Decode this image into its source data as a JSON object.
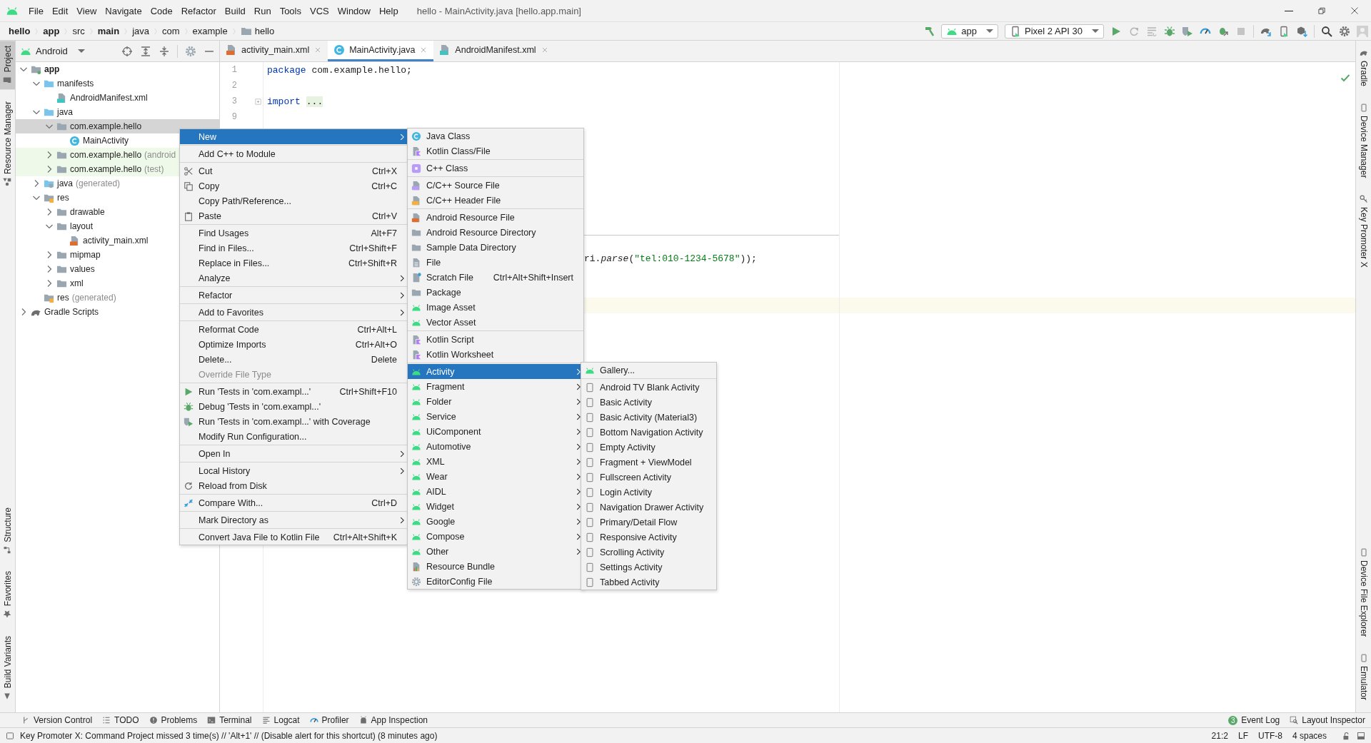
{
  "window": {
    "title": "hello - MainActivity.java [hello.app.main]"
  },
  "menu_bar": [
    "File",
    "Edit",
    "View",
    "Navigate",
    "Code",
    "Refactor",
    "Build",
    "Run",
    "Tools",
    "VCS",
    "Window",
    "Help"
  ],
  "breadcrumbs": [
    {
      "label": "hello",
      "bold": true,
      "folder_icon": false
    },
    {
      "label": "app",
      "bold": true,
      "folder_icon": false
    },
    {
      "label": "src",
      "bold": false,
      "folder_icon": false
    },
    {
      "label": "main",
      "bold": true,
      "folder_icon": false
    },
    {
      "label": "java",
      "bold": false,
      "folder_icon": false
    },
    {
      "label": "com",
      "bold": false,
      "folder_icon": false
    },
    {
      "label": "example",
      "bold": false,
      "folder_icon": false
    },
    {
      "label": "hello",
      "bold": false,
      "folder_icon": true
    }
  ],
  "toolbar": {
    "module_selector": "app",
    "device_selector": "Pixel 2 API 30"
  },
  "left_tool_windows": {
    "top": [
      {
        "label": "Project",
        "kind": "project",
        "selected": true
      },
      {
        "label": "Resource Manager",
        "kind": "resources",
        "selected": false
      }
    ],
    "bottom": [
      {
        "label": "Structure",
        "kind": "structure",
        "selected": false
      },
      {
        "label": "Favorites",
        "kind": "favorites",
        "selected": false
      },
      {
        "label": "Build Variants",
        "kind": "variants",
        "selected": false
      }
    ]
  },
  "right_tool_windows": {
    "top": [
      {
        "label": "Gradle",
        "kind": "gradle",
        "selected": false
      },
      {
        "label": "Device Manager",
        "kind": "device",
        "selected": false
      },
      {
        "label": "Key Promoter X",
        "kind": "key",
        "selected": false
      }
    ],
    "bottom": [
      {
        "label": "Device File Explorer",
        "kind": "device",
        "selected": false
      },
      {
        "label": "Emulator",
        "kind": "device",
        "selected": false
      }
    ]
  },
  "project_panel": {
    "view_selector": "Android",
    "tree": [
      {
        "label": "app",
        "kind": "module",
        "expanded": true,
        "selected": false,
        "children": [
          {
            "label": "manifests",
            "kind": "srcfolder",
            "expanded": true,
            "selected": false,
            "children": [
              {
                "label": "AndroidManifest.xml",
                "kind": "manifest",
                "selected": false
              }
            ]
          },
          {
            "label": "java",
            "kind": "srcfolder",
            "expanded": true,
            "selected": false,
            "children": [
              {
                "label": "com.example.hello",
                "kind": "package",
                "expanded": true,
                "selected": true,
                "children": [
                  {
                    "label": "MainActivity",
                    "kind": "class",
                    "selected": false
                  }
                ]
              },
              {
                "label": "com.example.hello",
                "suffix": "(android",
                "kind": "testpackage",
                "expanded": false,
                "selected": false
              },
              {
                "label": "com.example.hello",
                "suffix": "(test)",
                "kind": "testpackage",
                "expanded": false,
                "selected": false
              }
            ]
          },
          {
            "label": "java",
            "suffix": "(generated)",
            "kind": "genfolder",
            "expanded": false,
            "selected": false
          },
          {
            "label": "res",
            "kind": "resfolder",
            "expanded": true,
            "selected": false,
            "children": [
              {
                "label": "drawable",
                "kind": "package",
                "expanded": false,
                "selected": false
              },
              {
                "label": "layout",
                "kind": "package",
                "expanded": true,
                "selected": false,
                "children": [
                  {
                    "label": "activity_main.xml",
                    "kind": "xml",
                    "selected": false
                  }
                ]
              },
              {
                "label": "mipmap",
                "kind": "package",
                "expanded": false,
                "selected": false
              },
              {
                "label": "values",
                "kind": "package",
                "expanded": false,
                "selected": false
              },
              {
                "label": "xml",
                "kind": "package",
                "expanded": false,
                "selected": false
              }
            ]
          },
          {
            "label": "res",
            "suffix": "(generated)",
            "kind": "resfolder",
            "selected": false
          }
        ]
      },
      {
        "label": "Gradle Scripts",
        "kind": "gradle",
        "expanded": false,
        "selected": false
      }
    ]
  },
  "editor": {
    "tabs": [
      {
        "label": "activity_main.xml",
        "kind": "xml",
        "selected": false
      },
      {
        "label": "MainActivity.java",
        "kind": "class",
        "selected": true
      },
      {
        "label": "AndroidManifest.xml",
        "kind": "manifest",
        "selected": false
      }
    ],
    "lines": [
      {
        "number": "1",
        "tokens": [
          {
            "kind": "keyword",
            "text": "package"
          },
          {
            "kind": "plain",
            "text": " com.example.hello;"
          }
        ]
      },
      {
        "number": "2"
      },
      {
        "number": "3",
        "tokens": [
          {
            "kind": "keyword",
            "text": "import"
          },
          {
            "kind": "folded",
            "text": "..."
          }
        ]
      },
      {
        "number": "9"
      }
    ],
    "partly_hidden_line": [
      {
        "kind": "plain",
        "text": "ri."
      },
      {
        "kind": "method",
        "text": "parse"
      },
      {
        "kind": "plain",
        "text": "("
      },
      {
        "kind": "string",
        "text": "\"tel:010-1234-5678\""
      },
      {
        "kind": "plain",
        "text": "));"
      }
    ]
  },
  "context_menu": {
    "groups": [
      [
        {
          "label": "New",
          "submenu": true,
          "selected": true,
          "disabled": false
        }
      ],
      [
        {
          "label": "Add C++ to Module",
          "submenu": false,
          "selected": false,
          "disabled": false
        }
      ],
      [
        {
          "label": "Cut",
          "shortcut": "Ctrl+X",
          "kind": "cut",
          "submenu": false,
          "selected": false,
          "disabled": false
        },
        {
          "label": "Copy",
          "shortcut": "Ctrl+C",
          "kind": "copy",
          "submenu": false,
          "selected": false,
          "disabled": false
        },
        {
          "label": "Copy Path/Reference...",
          "submenu": false,
          "selected": false,
          "disabled": false
        },
        {
          "label": "Paste",
          "shortcut": "Ctrl+V",
          "kind": "paste",
          "submenu": false,
          "selected": false,
          "disabled": false
        }
      ],
      [
        {
          "label": "Find Usages",
          "shortcut": "Alt+F7",
          "submenu": false,
          "selected": false,
          "disabled": false
        },
        {
          "label": "Find in Files...",
          "shortcut": "Ctrl+Shift+F",
          "submenu": false,
          "selected": false,
          "disabled": false
        },
        {
          "label": "Replace in Files...",
          "shortcut": "Ctrl+Shift+R",
          "submenu": false,
          "selected": false,
          "disabled": false
        },
        {
          "label": "Analyze",
          "submenu": true,
          "selected": false,
          "disabled": false
        }
      ],
      [
        {
          "label": "Refactor",
          "submenu": true,
          "selected": false,
          "disabled": false
        }
      ],
      [
        {
          "label": "Add to Favorites",
          "submenu": true,
          "selected": false,
          "disabled": false
        }
      ],
      [
        {
          "label": "Reformat Code",
          "shortcut": "Ctrl+Alt+L",
          "submenu": false,
          "selected": false,
          "disabled": false
        },
        {
          "label": "Optimize Imports",
          "shortcut": "Ctrl+Alt+O",
          "submenu": false,
          "selected": false,
          "disabled": false
        },
        {
          "label": "Delete...",
          "shortcut": "Delete",
          "submenu": false,
          "selected": false,
          "disabled": false
        },
        {
          "label": "Override File Type",
          "submenu": false,
          "selected": false,
          "disabled": true
        }
      ],
      [
        {
          "label": "Run 'Tests in 'com.exampl...'",
          "shortcut": "Ctrl+Shift+F10",
          "kind": "run",
          "submenu": false,
          "selected": false,
          "disabled": false
        },
        {
          "label": "Debug 'Tests in 'com.exampl...'",
          "kind": "debug",
          "submenu": false,
          "selected": false,
          "disabled": false
        },
        {
          "label": "Run 'Tests in 'com.exampl...' with Coverage",
          "kind": "coverage",
          "submenu": false,
          "selected": false,
          "disabled": false
        },
        {
          "label": "Modify Run Configuration...",
          "submenu": false,
          "selected": false,
          "disabled": false
        }
      ],
      [
        {
          "label": "Open In",
          "submenu": true,
          "selected": false,
          "disabled": false
        }
      ],
      [
        {
          "label": "Local History",
          "submenu": true,
          "selected": false,
          "disabled": false
        },
        {
          "label": "Reload from Disk",
          "kind": "reload",
          "submenu": false,
          "selected": false,
          "disabled": false
        }
      ],
      [
        {
          "label": "Compare With...",
          "shortcut": "Ctrl+D",
          "kind": "compare",
          "submenu": false,
          "selected": false,
          "disabled": false
        }
      ],
      [
        {
          "label": "Mark Directory as",
          "submenu": true,
          "selected": false,
          "disabled": false
        }
      ],
      [
        {
          "label": "Convert Java File to Kotlin File",
          "shortcut": "Ctrl+Alt+Shift+K",
          "submenu": false,
          "selected": false,
          "disabled": false
        }
      ]
    ]
  },
  "new_submenu": {
    "groups": [
      [
        {
          "label": "Java Class",
          "kind": "class",
          "submenu": false,
          "selected": false
        },
        {
          "label": "Kotlin Class/File",
          "kind": "kotlin",
          "submenu": false,
          "selected": false
        }
      ],
      [
        {
          "label": "C++ Class",
          "kind": "cppclass",
          "submenu": false,
          "selected": false
        }
      ],
      [
        {
          "label": "C/C++ Source File",
          "kind": "cppsrc",
          "submenu": false,
          "selected": false
        },
        {
          "label": "C/C++ Header File",
          "kind": "cpphdr",
          "submenu": false,
          "selected": false
        }
      ],
      [
        {
          "label": "Android Resource File",
          "kind": "xml",
          "submenu": false,
          "selected": false
        },
        {
          "label": "Android Resource Directory",
          "kind": "folder",
          "submenu": false,
          "selected": false
        },
        {
          "label": "Sample Data Directory",
          "kind": "folder",
          "submenu": false,
          "selected": false
        },
        {
          "label": "File",
          "kind": "file",
          "submenu": false,
          "selected": false
        },
        {
          "label": "Scratch File",
          "shortcut": "Ctrl+Alt+Shift+Insert",
          "kind": "scratch",
          "submenu": false,
          "selected": false
        },
        {
          "label": "Package",
          "kind": "package",
          "submenu": false,
          "selected": false
        },
        {
          "label": "Image Asset",
          "kind": "android",
          "submenu": false,
          "selected": false
        },
        {
          "label": "Vector Asset",
          "kind": "android",
          "submenu": false,
          "selected": false
        }
      ],
      [
        {
          "label": "Kotlin Script",
          "kind": "kotlin",
          "submenu": false,
          "selected": false
        },
        {
          "label": "Kotlin Worksheet",
          "kind": "kotlin",
          "submenu": false,
          "selected": false
        }
      ],
      [
        {
          "label": "Activity",
          "kind": "android",
          "submenu": true,
          "selected": true
        },
        {
          "label": "Fragment",
          "kind": "android",
          "submenu": true,
          "selected": false
        },
        {
          "label": "Folder",
          "kind": "android",
          "submenu": true,
          "selected": false
        },
        {
          "label": "Service",
          "kind": "android",
          "submenu": true,
          "selected": false
        },
        {
          "label": "UiComponent",
          "kind": "android",
          "submenu": true,
          "selected": false
        },
        {
          "label": "Automotive",
          "kind": "android",
          "submenu": true,
          "selected": false
        },
        {
          "label": "XML",
          "kind": "android",
          "submenu": true,
          "selected": false
        },
        {
          "label": "Wear",
          "kind": "android",
          "submenu": true,
          "selected": false
        },
        {
          "label": "AIDL",
          "kind": "android",
          "submenu": true,
          "selected": false
        },
        {
          "label": "Widget",
          "kind": "android",
          "submenu": true,
          "selected": false
        },
        {
          "label": "Google",
          "kind": "android",
          "submenu": true,
          "selected": false
        },
        {
          "label": "Compose",
          "kind": "android",
          "submenu": true,
          "selected": false
        },
        {
          "label": "Other",
          "kind": "android",
          "submenu": true,
          "selected": false
        },
        {
          "label": "Resource Bundle",
          "kind": "bundle",
          "submenu": false,
          "selected": false
        },
        {
          "label": "EditorConfig File",
          "kind": "gear",
          "submenu": false,
          "selected": false
        }
      ]
    ]
  },
  "activity_submenu": {
    "groups": [
      [
        {
          "label": "Gallery...",
          "kind": "android",
          "selected": false
        }
      ],
      [
        {
          "label": "Android TV Blank Activity",
          "kind": "template",
          "selected": false
        },
        {
          "label": "Basic Activity",
          "kind": "template",
          "selected": false
        },
        {
          "label": "Basic Activity (Material3)",
          "kind": "template",
          "selected": false
        },
        {
          "label": "Bottom Navigation Activity",
          "kind": "template",
          "selected": false
        },
        {
          "label": "Empty Activity",
          "kind": "template",
          "selected": false
        },
        {
          "label": "Fragment + ViewModel",
          "kind": "template",
          "selected": false
        },
        {
          "label": "Fullscreen Activity",
          "kind": "template",
          "selected": false
        },
        {
          "label": "Login Activity",
          "kind": "template",
          "selected": false
        },
        {
          "label": "Navigation Drawer Activity",
          "kind": "template",
          "selected": false
        },
        {
          "label": "Primary/Detail Flow",
          "kind": "template",
          "selected": false
        },
        {
          "label": "Responsive Activity",
          "kind": "template",
          "selected": false
        },
        {
          "label": "Scrolling Activity",
          "kind": "template",
          "selected": false
        },
        {
          "label": "Settings Activity",
          "kind": "template",
          "selected": false
        },
        {
          "label": "Tabbed Activity",
          "kind": "template",
          "selected": false
        }
      ]
    ]
  },
  "bottom_tool_windows": {
    "left": [
      {
        "label": "Version Control",
        "kind": "vcs"
      },
      {
        "label": "TODO",
        "kind": "todo"
      },
      {
        "label": "Problems",
        "kind": "problems"
      },
      {
        "label": "Terminal",
        "kind": "terminal"
      },
      {
        "label": "Logcat",
        "kind": "logcat"
      },
      {
        "label": "Profiler",
        "kind": "profile"
      },
      {
        "label": "App Inspection",
        "kind": "inspection"
      }
    ],
    "right": [
      {
        "label": "Event Log",
        "badge": "3"
      },
      {
        "label": "Layout Inspector",
        "kind": "layoutinsp"
      }
    ]
  },
  "status_bar": {
    "message": "Key Promoter X: Command Project missed 3 time(s) // 'Alt+1' // (Disable alert for this shortcut) (8 minutes ago)",
    "items": [
      "21:2",
      "LF",
      "UTF-8",
      "4 spaces"
    ]
  }
}
